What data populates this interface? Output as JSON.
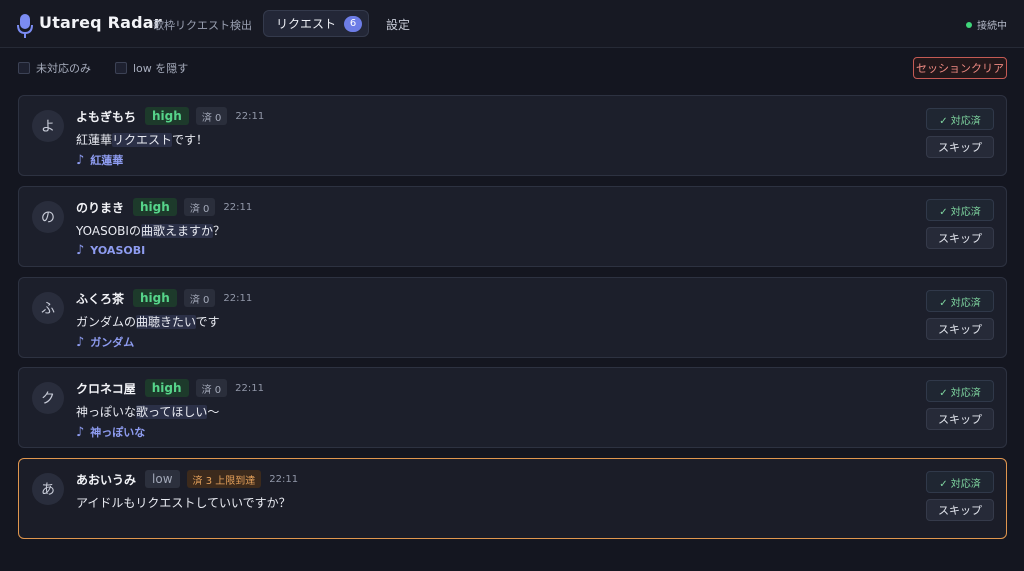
{
  "header": {
    "title": "Utareq Radar",
    "subtitle": "歌枠リクエスト検出",
    "tab_requests": "リクエスト",
    "tab_requests_count": "6",
    "tab_settings": "設定",
    "status": "接続中",
    "logo_icon": "microphone-icon"
  },
  "filters": {
    "unhandled_only": "未対応のみ",
    "hide_low": "low を隠す",
    "clear_session": "セッションクリア"
  },
  "colors": {
    "accent": "#6d7de6",
    "high": "#56d48a",
    "warning": "#e0964e",
    "danger": "#c45a54"
  },
  "requests": [
    {
      "avatar": "よ",
      "name": "よもぎもち",
      "priority": "high",
      "count": "済 0",
      "time": "22:11",
      "msg_pre": "紅蓮華",
      "msg_hl": "リクエスト",
      "msg_post": "です！",
      "song": "紅蓮華",
      "done": "✓ 対応済",
      "skip": "スキップ"
    },
    {
      "avatar": "の",
      "name": "のりまき",
      "priority": "high",
      "count": "済 0",
      "time": "22:11",
      "msg_pre": "YOASOBIの",
      "msg_hl": "曲歌えますか",
      "msg_post": "？",
      "song": "YOASOBI",
      "done": "✓ 対応済",
      "skip": "スキップ"
    },
    {
      "avatar": "ふ",
      "name": "ふくろ茶",
      "priority": "high",
      "count": "済 0",
      "time": "22:11",
      "msg_pre": "ガンダムの",
      "msg_hl": "曲聴きたい",
      "msg_post": "です",
      "song": "ガンダム",
      "done": "✓ 対応済",
      "skip": "スキップ"
    },
    {
      "avatar": "ク",
      "name": "クロネコ屋",
      "priority": "high",
      "count": "済 0",
      "time": "22:11",
      "msg_pre": "神っぽいな",
      "msg_hl": "歌ってほしい",
      "msg_post": "〜",
      "song": "神っぽいな",
      "done": "✓ 対応済",
      "skip": "スキップ"
    },
    {
      "avatar": "あ",
      "name": "あおいうみ",
      "priority": "low",
      "count": "済 3 上限到達",
      "time": "22:11",
      "msg_pre": "アイドルもリクエストしていいですか？",
      "msg_hl": "",
      "msg_post": "",
      "song": "",
      "done": "✓ 対応済",
      "skip": "スキップ"
    }
  ]
}
